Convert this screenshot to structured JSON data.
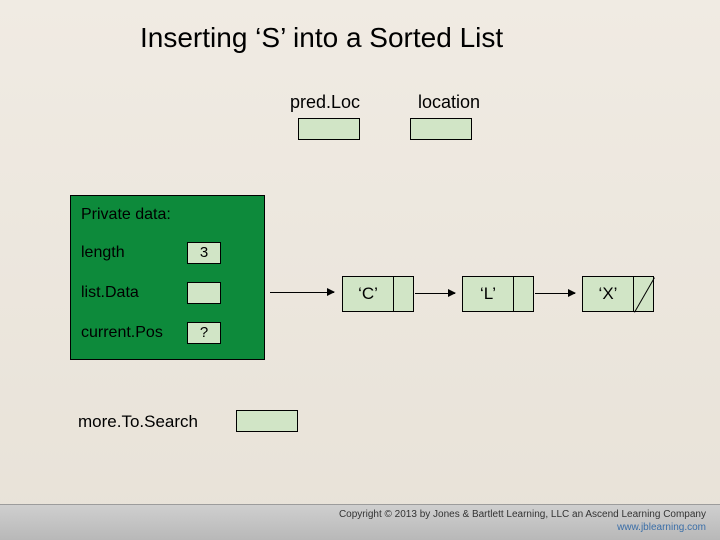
{
  "title": "Inserting ‘S’ into a Sorted List",
  "pointers": {
    "predLoc": {
      "label": "pred.Loc",
      "value": ""
    },
    "location": {
      "label": "location",
      "value": ""
    }
  },
  "object": {
    "header": "Private data:",
    "length": {
      "label": "length",
      "value": "3"
    },
    "listData": {
      "label": "list.Data",
      "value": ""
    },
    "currentPos": {
      "label": "current.Pos",
      "value": "?"
    }
  },
  "nodes": [
    {
      "value": "‘C’",
      "next": true
    },
    {
      "value": "‘L’",
      "next": true
    },
    {
      "value": "‘X’",
      "next": false
    }
  ],
  "moreToSearch": {
    "label": "more.To.Search",
    "value": ""
  },
  "footer": {
    "copyright": "Copyright © 2013 by Jones & Bartlett Learning, LLC an Ascend Learning Company",
    "url": "www.jblearning.com"
  }
}
